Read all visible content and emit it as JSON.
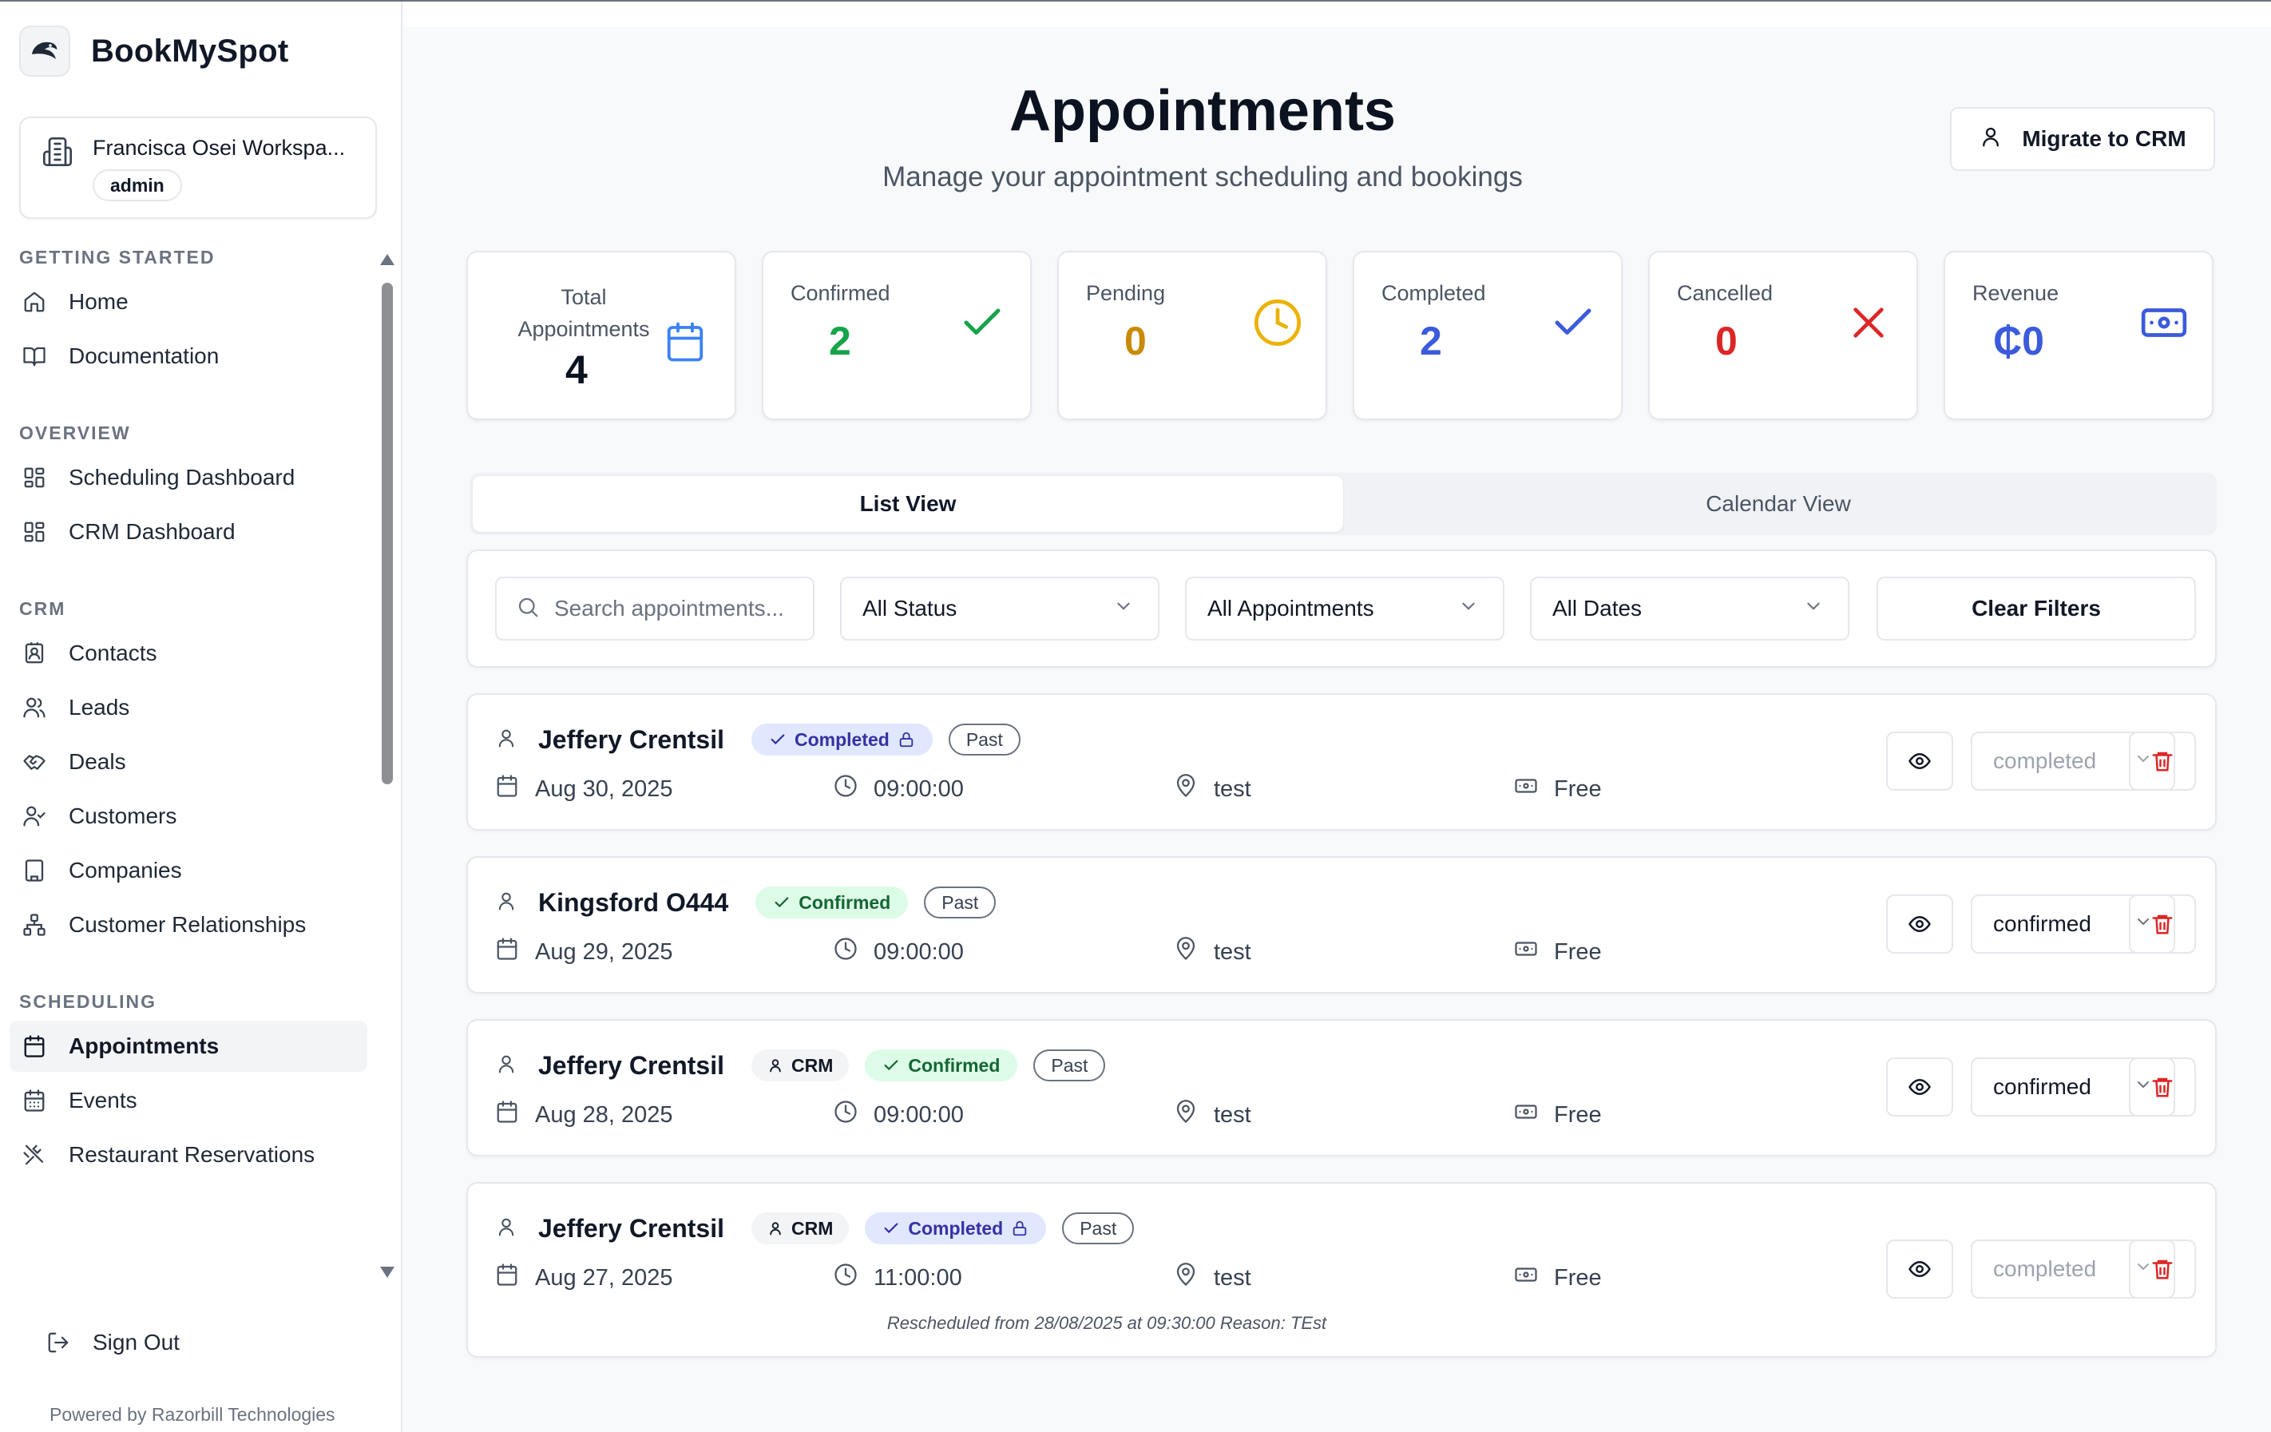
{
  "brand": {
    "name": "BookMySpot"
  },
  "workspace": {
    "name": "Francisca Osei Workspa...",
    "role": "admin"
  },
  "nav": {
    "getting_started": {
      "title": "GETTING STARTED",
      "items": [
        {
          "label": "Home",
          "icon": "home-icon"
        },
        {
          "label": "Documentation",
          "icon": "book-icon"
        }
      ]
    },
    "overview": {
      "title": "OVERVIEW",
      "items": [
        {
          "label": "Scheduling Dashboard",
          "icon": "grid-icon"
        },
        {
          "label": "CRM Dashboard",
          "icon": "grid-icon"
        }
      ]
    },
    "crm": {
      "title": "CRM",
      "items": [
        {
          "label": "Contacts",
          "icon": "contact-icon"
        },
        {
          "label": "Leads",
          "icon": "users-icon"
        },
        {
          "label": "Deals",
          "icon": "handshake-icon"
        },
        {
          "label": "Customers",
          "icon": "user-check-icon"
        },
        {
          "label": "Companies",
          "icon": "building-icon"
        },
        {
          "label": "Customer Relationships",
          "icon": "network-icon"
        }
      ]
    },
    "scheduling": {
      "title": "SCHEDULING",
      "items": [
        {
          "label": "Appointments",
          "icon": "calendar-icon",
          "active": true
        },
        {
          "label": "Events",
          "icon": "calendar-grid-icon"
        },
        {
          "label": "Restaurant Reservations",
          "icon": "utensils-icon"
        }
      ]
    },
    "sign_out": "Sign Out",
    "powered_by": "Powered by Razorbill Technologies"
  },
  "header": {
    "title": "Appointments",
    "subtitle": "Manage your appointment scheduling and bookings",
    "migrate_label": "Migrate to CRM"
  },
  "stats": [
    {
      "label": "Total Appointments",
      "value": "4",
      "icon": "calendar-icon",
      "color": "#3b82f6",
      "value_color": "#0b1220"
    },
    {
      "label": "Confirmed",
      "value": "2",
      "icon": "check-icon",
      "color": "#16a34a",
      "value_color": "#16a34a"
    },
    {
      "label": "Pending",
      "value": "0",
      "icon": "clock-icon",
      "color": "#eab308",
      "value_color": "#ca8a04"
    },
    {
      "label": "Completed",
      "value": "2",
      "icon": "check-icon",
      "color": "#3b5bdb",
      "value_color": "#3b5bdb"
    },
    {
      "label": "Cancelled",
      "value": "0",
      "icon": "x-icon",
      "color": "#dc2626",
      "value_color": "#dc2626"
    },
    {
      "label": "Revenue",
      "value": "₵0",
      "icon": "banknote-icon",
      "color": "#3b5bdb",
      "value_color": "#3b5bdb"
    }
  ],
  "tabs": {
    "list": "List View",
    "calendar": "Calendar View",
    "active": "list"
  },
  "filters": {
    "search_placeholder": "Search appointments...",
    "status": "All Status",
    "type": "All Appointments",
    "dates": "All Dates",
    "clear_label": "Clear Filters"
  },
  "appointments": [
    {
      "name": "Jeffery Crentsil",
      "crm": false,
      "status_badge": "Completed",
      "status_type": "completed",
      "locked": true,
      "timing": "Past",
      "date": "Aug 30, 2025",
      "time": "09:00:00",
      "location": "test",
      "price": "Free",
      "status_value": "completed"
    },
    {
      "name": "Kingsford O444",
      "crm": false,
      "status_badge": "Confirmed",
      "status_type": "confirmed",
      "locked": false,
      "timing": "Past",
      "date": "Aug 29, 2025",
      "time": "09:00:00",
      "location": "test",
      "price": "Free",
      "status_value": "confirmed"
    },
    {
      "name": "Jeffery Crentsil",
      "crm": true,
      "crm_label": "CRM",
      "status_badge": "Confirmed",
      "status_type": "confirmed",
      "locked": false,
      "timing": "Past",
      "date": "Aug 28, 2025",
      "time": "09:00:00",
      "location": "test",
      "price": "Free",
      "status_value": "confirmed"
    },
    {
      "name": "Jeffery Crentsil",
      "crm": true,
      "crm_label": "CRM",
      "status_badge": "Completed",
      "status_type": "completed",
      "locked": true,
      "timing": "Past",
      "date": "Aug 27, 2025",
      "time": "11:00:00",
      "location": "test",
      "price": "Free",
      "status_value": "completed",
      "note": "Rescheduled from 28/08/2025 at 09:30:00 Reason: TEst"
    }
  ]
}
